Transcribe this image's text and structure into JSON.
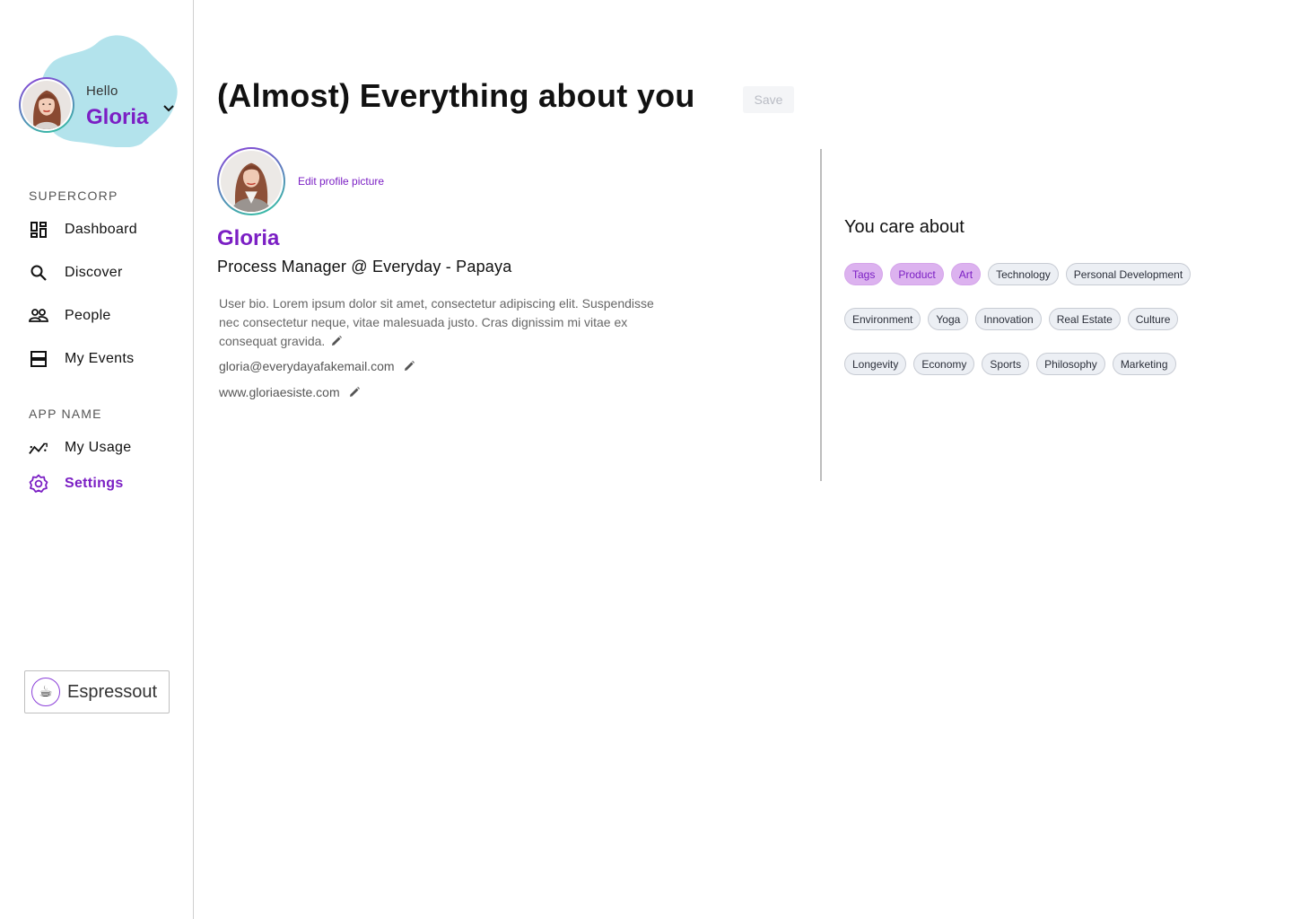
{
  "sidebar": {
    "greeting": "Hello",
    "user_name": "Gloria",
    "sections": [
      {
        "label": "SUPERCORP",
        "items": [
          {
            "label": "Dashboard",
            "icon": "dashboard-icon"
          },
          {
            "label": "Discover",
            "icon": "search-icon"
          },
          {
            "label": "People",
            "icon": "people-icon"
          },
          {
            "label": "My Events",
            "icon": "events-icon"
          }
        ]
      },
      {
        "label": "APP NAME",
        "items": [
          {
            "label": "My Usage",
            "icon": "usage-chart-icon"
          },
          {
            "label": "Settings",
            "icon": "gear-icon",
            "active": true
          }
        ]
      }
    ],
    "workspace": {
      "name": "Espressout",
      "logo": "☕"
    }
  },
  "main": {
    "title": "(Almost) Everything about you",
    "save_label": "Save",
    "edit_picture_label": "Edit profile picture",
    "profile": {
      "name": "Gloria",
      "role": "Process Manager @ Everyday - Papaya",
      "bio": "User bio. Lorem ipsum dolor sit amet, consectetur adipiscing elit. Suspendisse nec consectetur neque, vitae malesuada justo. Cras dignissim mi vitae ex consequat gravida.",
      "email": "gloria@everydayafakemail.com",
      "website": "www.gloriaesiste.com"
    },
    "interests": {
      "title": "You care about",
      "rows": [
        [
          {
            "label": "Tags",
            "selected": true
          },
          {
            "label": "Product",
            "selected": true
          },
          {
            "label": "Art",
            "selected": true
          },
          {
            "label": "Technology",
            "selected": false
          },
          {
            "label": "Personal Development",
            "selected": false
          }
        ],
        [
          {
            "label": "Environment",
            "selected": false
          },
          {
            "label": "Yoga",
            "selected": false
          },
          {
            "label": "Innovation",
            "selected": false
          },
          {
            "label": "Real Estate",
            "selected": false
          },
          {
            "label": "Culture",
            "selected": false
          }
        ],
        [
          {
            "label": "Longevity",
            "selected": false
          },
          {
            "label": "Economy",
            "selected": false
          },
          {
            "label": "Sports",
            "selected": false
          },
          {
            "label": "Philosophy",
            "selected": false
          },
          {
            "label": "Marketing",
            "selected": false
          }
        ]
      ]
    }
  },
  "colors": {
    "accent": "#7b1fc4",
    "blob": "#b3e3ec",
    "tag_selected": "#dcb2ef",
    "tag_default": "#eceff4"
  }
}
